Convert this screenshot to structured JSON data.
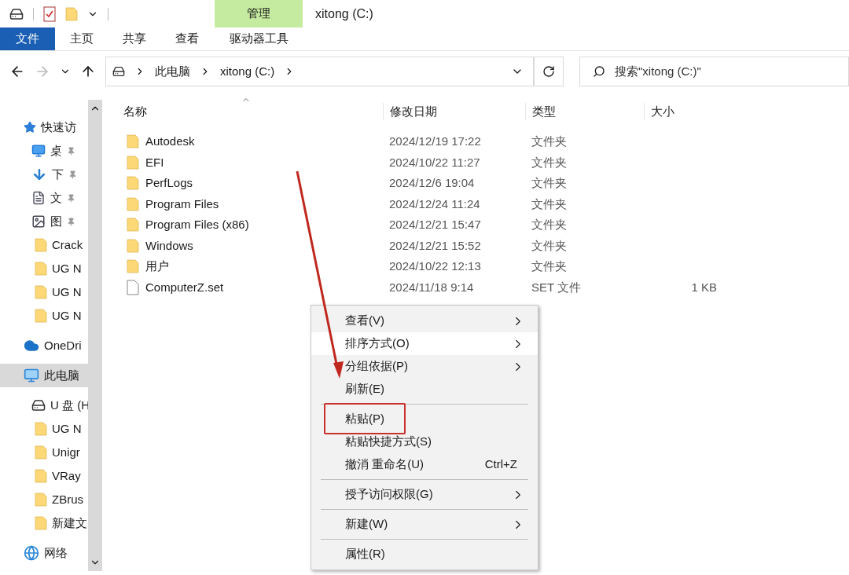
{
  "window": {
    "title": "xitong (C:)"
  },
  "contextual_tab": {
    "group": "管理",
    "tab": "驱动器工具"
  },
  "ribbon_tabs": [
    {
      "label": "文件",
      "kind": "file"
    },
    {
      "label": "主页",
      "kind": "tab"
    },
    {
      "label": "共享",
      "kind": "tab"
    },
    {
      "label": "查看",
      "kind": "tab"
    }
  ],
  "address_bar": {
    "path": [
      "此电脑",
      "xitong (C:)"
    ]
  },
  "search": {
    "placeholder": "搜索\"xitong (C:)\""
  },
  "sidebar": {
    "items": [
      {
        "label": "快速访",
        "kind": "star",
        "pinned": false,
        "selected": false
      },
      {
        "label": "桌",
        "kind": "desktop",
        "pinned": true,
        "selected": false
      },
      {
        "label": "下",
        "kind": "download",
        "pinned": true,
        "selected": false
      },
      {
        "label": "文",
        "kind": "document",
        "pinned": true,
        "selected": false
      },
      {
        "label": "图",
        "kind": "image",
        "pinned": true,
        "selected": false
      },
      {
        "label": "Crack",
        "kind": "folder",
        "pinned": false,
        "selected": false
      },
      {
        "label": "UG N",
        "kind": "folder",
        "pinned": false,
        "selected": false
      },
      {
        "label": "UG N",
        "kind": "folder",
        "pinned": false,
        "selected": false
      },
      {
        "label": "UG N",
        "kind": "folder",
        "pinned": false,
        "selected": false
      },
      {
        "label": "OneDri",
        "kind": "cloud",
        "pinned": false,
        "selected": false
      },
      {
        "label": "此电脑",
        "kind": "pc",
        "pinned": false,
        "selected": true
      },
      {
        "label": "U 盘 (H",
        "kind": "drive",
        "pinned": false,
        "selected": false
      },
      {
        "label": "UG N",
        "kind": "folder",
        "pinned": false,
        "selected": false
      },
      {
        "label": "Unigr",
        "kind": "folder",
        "pinned": false,
        "selected": false
      },
      {
        "label": "VRay",
        "kind": "folder",
        "pinned": false,
        "selected": false
      },
      {
        "label": "ZBrus",
        "kind": "folder",
        "pinned": false,
        "selected": false
      },
      {
        "label": "新建文",
        "kind": "folder",
        "pinned": false,
        "selected": false
      },
      {
        "label": "网络",
        "kind": "network",
        "pinned": false,
        "selected": false
      }
    ]
  },
  "columns": [
    "名称",
    "修改日期",
    "类型",
    "大小"
  ],
  "rows": [
    {
      "name": "Autodesk",
      "date": "2024/12/19 17:22",
      "type": "文件夹",
      "kind": "folder"
    },
    {
      "name": "EFI",
      "date": "2024/10/22 11:27",
      "type": "文件夹",
      "kind": "folder"
    },
    {
      "name": "PerfLogs",
      "date": "2024/12/6 19:04",
      "type": "文件夹",
      "kind": "folder"
    },
    {
      "name": "Program Files",
      "date": "2024/12/24 11:24",
      "type": "文件夹",
      "kind": "folder"
    },
    {
      "name": "Program Files (x86)",
      "date": "2024/12/21 15:47",
      "type": "文件夹",
      "kind": "folder"
    },
    {
      "name": "Windows",
      "date": "2024/12/21 15:52",
      "type": "文件夹",
      "kind": "folder"
    },
    {
      "name": "用户",
      "date": "2024/10/22 12:13",
      "type": "文件夹",
      "kind": "folder"
    },
    {
      "name": "ComputerZ.set",
      "date": "2024/11/18 9:14",
      "type": "SET 文件",
      "size": "1 KB",
      "kind": "file"
    }
  ],
  "context_menu": {
    "items": [
      {
        "kind": "item",
        "label": "查看(V)",
        "submenu": true,
        "selected": false,
        "highlighted": false
      },
      {
        "kind": "item",
        "label": "排序方式(O)",
        "submenu": true,
        "selected": true,
        "highlighted": false
      },
      {
        "kind": "item",
        "label": "分组依据(P)",
        "submenu": true,
        "selected": false,
        "highlighted": false
      },
      {
        "kind": "item",
        "label": "刷新(E)",
        "submenu": false,
        "selected": false,
        "highlighted": false
      },
      {
        "kind": "separator"
      },
      {
        "kind": "item",
        "label": "粘贴(P)",
        "submenu": false,
        "selected": false,
        "highlighted": true
      },
      {
        "kind": "item",
        "label": "粘贴快捷方式(S)",
        "submenu": false,
        "selected": false,
        "highlighted": false
      },
      {
        "kind": "item",
        "label": "撤消 重命名(U)",
        "shortcut": "Ctrl+Z",
        "submenu": false,
        "selected": false,
        "highlighted": false
      },
      {
        "kind": "separator"
      },
      {
        "kind": "item",
        "label": "授予访问权限(G)",
        "submenu": true,
        "selected": false,
        "highlighted": false
      },
      {
        "kind": "separator"
      },
      {
        "kind": "item",
        "label": "新建(W)",
        "submenu": true,
        "selected": false,
        "highlighted": false
      },
      {
        "kind": "separator"
      },
      {
        "kind": "item",
        "label": "属性(R)",
        "submenu": false,
        "selected": false,
        "highlighted": false
      }
    ]
  }
}
